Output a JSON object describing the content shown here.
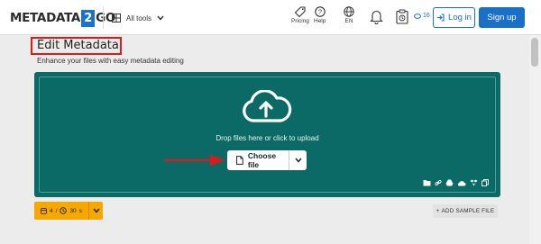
{
  "header": {
    "logo": {
      "left": "METADATA",
      "middle": "2",
      "right": "GO"
    },
    "all_tools": "All tools",
    "pricing": "Pricing",
    "help": "Help",
    "language": "EN",
    "credits": "16",
    "login": "Log in",
    "signup": "Sign up"
  },
  "main": {
    "title": "Edit Metadata",
    "subtitle": "Enhance your files with easy metadata editing",
    "drop_text": "Drop files here or click to upload",
    "choose_file": "Choose file",
    "speed": {
      "files": "4",
      "seconds": "30",
      "unit": "s"
    },
    "sample_button": "ADD SAMPLE FILE"
  },
  "colors": {
    "brand_blue": "#1a6fc9",
    "dropzone_teal": "#0b6a66",
    "highlight_red": "#e01818",
    "speed_orange": "#f5a800"
  },
  "icons": [
    "grid-icon",
    "chevron-down-icon",
    "tag-icon",
    "help-icon",
    "globe-icon",
    "bell-icon",
    "clipboard-icon",
    "login-arrow-icon",
    "cloud-upload-icon",
    "file-icon",
    "folder-icon",
    "link-icon",
    "google-drive-icon",
    "onedrive-icon",
    "dropbox-icon",
    "copy-icon"
  ]
}
